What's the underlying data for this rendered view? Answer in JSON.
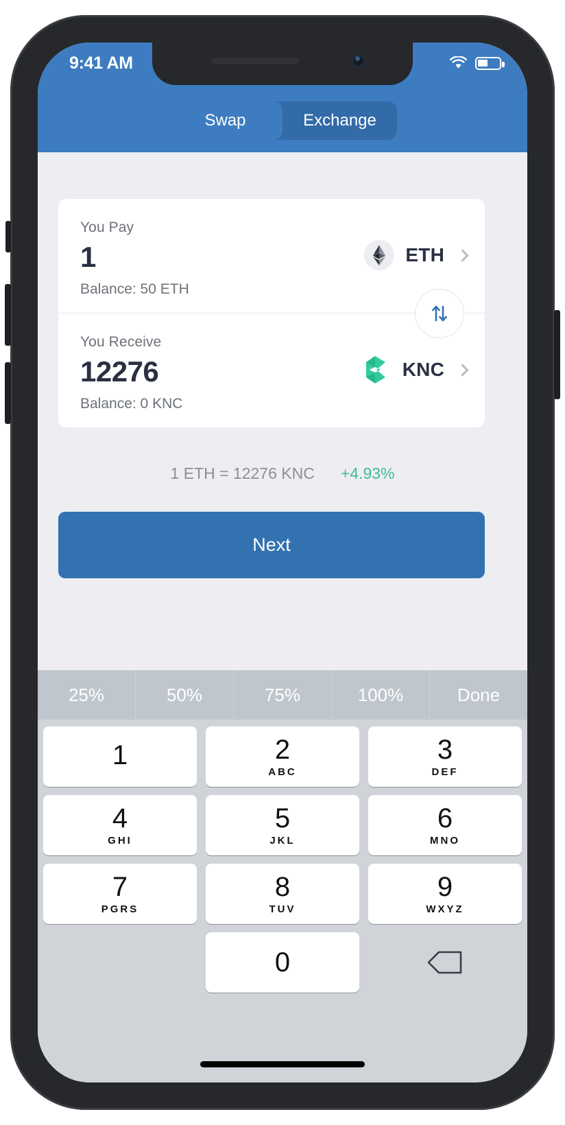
{
  "status_bar": {
    "time": "9:41 AM",
    "wifi_icon": "wifi-icon",
    "battery_icon": "battery-icon"
  },
  "header": {
    "background_color": "#3d7cc0",
    "tabs": [
      {
        "label": "Swap",
        "active": true
      },
      {
        "label": "Exchange",
        "active": false
      }
    ]
  },
  "swap": {
    "pay": {
      "label": "You Pay",
      "amount": "1",
      "balance": "Balance: 50 ETH",
      "token_symbol": "ETH",
      "token_icon": "ethereum-icon",
      "chevron_icon": "chevron-right-icon"
    },
    "receive": {
      "label": "You Receive",
      "amount": "12276",
      "balance": "Balance: 0 KNC",
      "token_symbol": "KNC",
      "token_icon": "kyber-network-icon",
      "chevron_icon": "chevron-right-icon"
    },
    "toggle_icon": "swap-vertical-arrows-icon",
    "rate_text": "1 ETH = 12276  KNC",
    "rate_change": "+4.93%",
    "rate_change_color": "#3fbd93",
    "next_label": "Next",
    "next_color": "#3272b0"
  },
  "keyboard": {
    "toolbar": [
      {
        "label": "25%"
      },
      {
        "label": "50%"
      },
      {
        "label": "75%"
      },
      {
        "label": "100%"
      },
      {
        "label": "Done"
      }
    ],
    "rows": [
      [
        {
          "digit": "1",
          "letters": ""
        },
        {
          "digit": "2",
          "letters": "ABC"
        },
        {
          "digit": "3",
          "letters": "DEF"
        }
      ],
      [
        {
          "digit": "4",
          "letters": "GHI"
        },
        {
          "digit": "5",
          "letters": "JKL"
        },
        {
          "digit": "6",
          "letters": "MNO"
        }
      ],
      [
        {
          "digit": "7",
          "letters": "PGRS"
        },
        {
          "digit": "8",
          "letters": "TUV"
        },
        {
          "digit": "9",
          "letters": "WXYZ"
        }
      ],
      [
        {
          "digit": "",
          "letters": "",
          "type": "blank"
        },
        {
          "digit": "0",
          "letters": ""
        },
        {
          "digit": "",
          "letters": "",
          "type": "delete",
          "icon": "backspace-icon"
        }
      ]
    ]
  }
}
